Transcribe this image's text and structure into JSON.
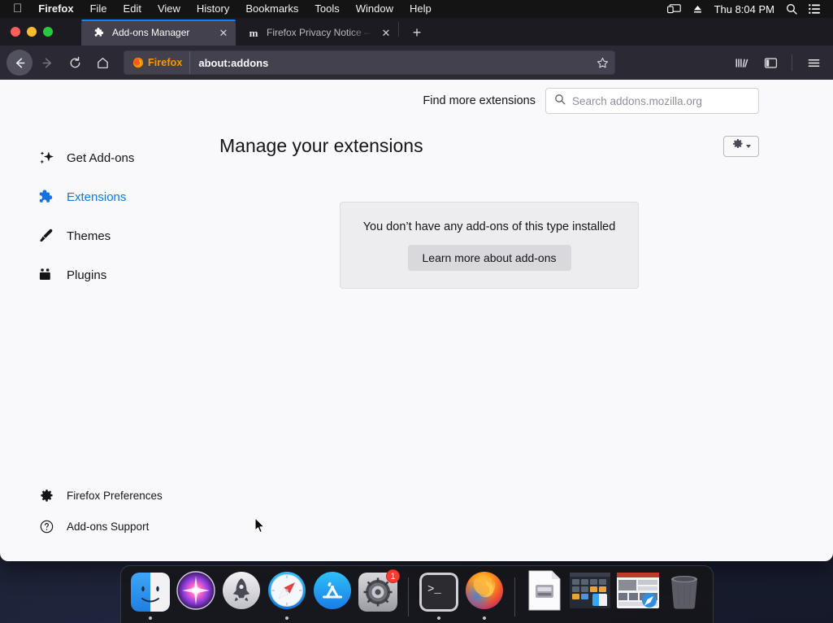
{
  "menubar": {
    "apple_icon": "apple-logo-icon",
    "items": [
      {
        "label": "Firefox",
        "bold": true
      },
      {
        "label": "File",
        "bold": false
      },
      {
        "label": "Edit",
        "bold": false
      },
      {
        "label": "View",
        "bold": false
      },
      {
        "label": "History",
        "bold": false
      },
      {
        "label": "Bookmarks",
        "bold": false
      },
      {
        "label": "Tools",
        "bold": false
      },
      {
        "label": "Window",
        "bold": false
      },
      {
        "label": "Help",
        "bold": false
      }
    ],
    "status_icons": [
      "screen-mirroring-icon",
      "eject-icon"
    ],
    "clock": "Thu 8:04 PM",
    "right_icons": [
      "spotlight-search-icon",
      "control-center-icon"
    ]
  },
  "window": {
    "traffic_lights": {
      "close": "#ff5f57",
      "minimize": "#febc2e",
      "zoom": "#28c840"
    },
    "tabs": [
      {
        "title": "Add-ons Manager",
        "favicon": "puzzle-piece-icon",
        "active": true
      },
      {
        "title": "Firefox Privacy Notice — Mozilla",
        "favicon": "mozilla-m-icon",
        "active": false
      }
    ],
    "new_tab_label": "+",
    "close_tab_label": "✕"
  },
  "toolbar": {
    "back_label": "←",
    "forward_label": "→",
    "reload_label": "⟳",
    "home_label": "⌂",
    "identity_label": "Firefox",
    "url": "about:addons",
    "bookmark_icon": "star-icon",
    "library_icon": "library-icon",
    "sidebar_icon": "sidebar-icon",
    "menu_icon": "hamburger-menu-icon"
  },
  "page": {
    "find_more_label": "Find more extensions",
    "search": {
      "placeholder": "Search addons.mozilla.org",
      "value": "",
      "icon": "search-icon"
    },
    "sidebar": {
      "items": [
        {
          "label": "Get Add-ons",
          "icon": "sparkle-icon",
          "active": false
        },
        {
          "label": "Extensions",
          "icon": "puzzle-piece-icon",
          "active": true
        },
        {
          "label": "Themes",
          "icon": "paintbrush-icon",
          "active": false
        },
        {
          "label": "Plugins",
          "icon": "plugin-icon",
          "active": false
        }
      ],
      "footer": [
        {
          "label": "Firefox Preferences",
          "icon": "gear-icon"
        },
        {
          "label": "Add-ons Support",
          "icon": "question-circle-icon"
        }
      ]
    },
    "main": {
      "title": "Manage your extensions",
      "options_button": {
        "icon": "gear-icon",
        "caret": "chevron-down-icon"
      },
      "empty_state": {
        "message": "You don’t have any add-ons of this type installed",
        "button_label": "Learn more about add-ons"
      }
    },
    "accent_color": "#0a7ae5",
    "background_color": "#f9f9fb"
  },
  "dock": {
    "items": [
      {
        "name": "finder",
        "running": true
      },
      {
        "name": "siri",
        "running": false
      },
      {
        "name": "launchpad",
        "running": false
      },
      {
        "name": "safari",
        "running": true
      },
      {
        "name": "app-store",
        "running": false
      },
      {
        "name": "system-preferences",
        "running": false,
        "badge": "1"
      },
      {
        "name": "terminal",
        "running": true
      },
      {
        "name": "firefox",
        "running": true
      },
      {
        "name": "document",
        "running": false
      },
      {
        "name": "window-thumbnail-1",
        "running": false
      },
      {
        "name": "window-thumbnail-2",
        "running": false
      },
      {
        "name": "trash",
        "running": false
      }
    ]
  }
}
